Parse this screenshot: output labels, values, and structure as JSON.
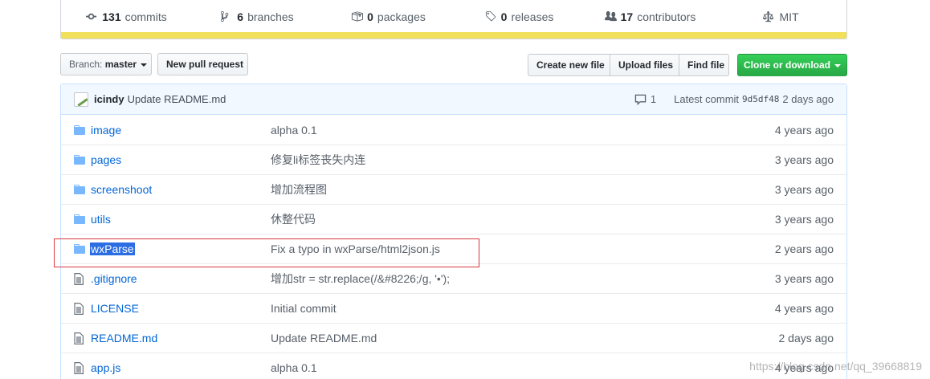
{
  "summary": {
    "commits_count": "131",
    "commits_label": "commits",
    "branches_count": "6",
    "branches_label": "branches",
    "packages_count": "0",
    "packages_label": "packages",
    "releases_count": "0",
    "releases_label": "releases",
    "contributors_count": "17",
    "contributors_label": "contributors",
    "license": "MIT",
    "lang_color": "#f1e05a"
  },
  "toolbar": {
    "branch_prefix": "Branch:",
    "branch_name": "master",
    "new_pr": "New pull request",
    "create_file": "Create new file",
    "upload_files": "Upload files",
    "find_file": "Find file",
    "clone": "Clone or download"
  },
  "commit": {
    "author": "icindy",
    "message": "Update README.md",
    "comments": "1",
    "latest_label": "Latest commit",
    "sha": "9d5df48",
    "age": "2 days ago"
  },
  "files": [
    {
      "type": "folder",
      "name": "image",
      "message": "alpha 0.1",
      "age": "4 years ago"
    },
    {
      "type": "folder",
      "name": "pages",
      "message": "修复li标签丧失内连",
      "age": "3 years ago"
    },
    {
      "type": "folder",
      "name": "screenshoot",
      "message": "增加流程图",
      "age": "3 years ago"
    },
    {
      "type": "folder",
      "name": "utils",
      "message": "休整代码",
      "age": "3 years ago"
    },
    {
      "type": "folder",
      "name": "wxParse",
      "message": "Fix a typo in wxParse/html2json.js",
      "age": "2 years ago"
    },
    {
      "type": "file",
      "name": ".gitignore",
      "message": "增加str = str.replace(/&#8226;/g, '•');",
      "age": "3 years ago"
    },
    {
      "type": "file",
      "name": "LICENSE",
      "message": "Initial commit",
      "age": "4 years ago"
    },
    {
      "type": "file",
      "name": "README.md",
      "message": "Update README.md",
      "age": "2 days ago"
    },
    {
      "type": "file",
      "name": "app.js",
      "message": "alpha 0.1",
      "age": "4 years ago"
    }
  ],
  "watermark": "https://blog.csdn.net/qq_39668819"
}
